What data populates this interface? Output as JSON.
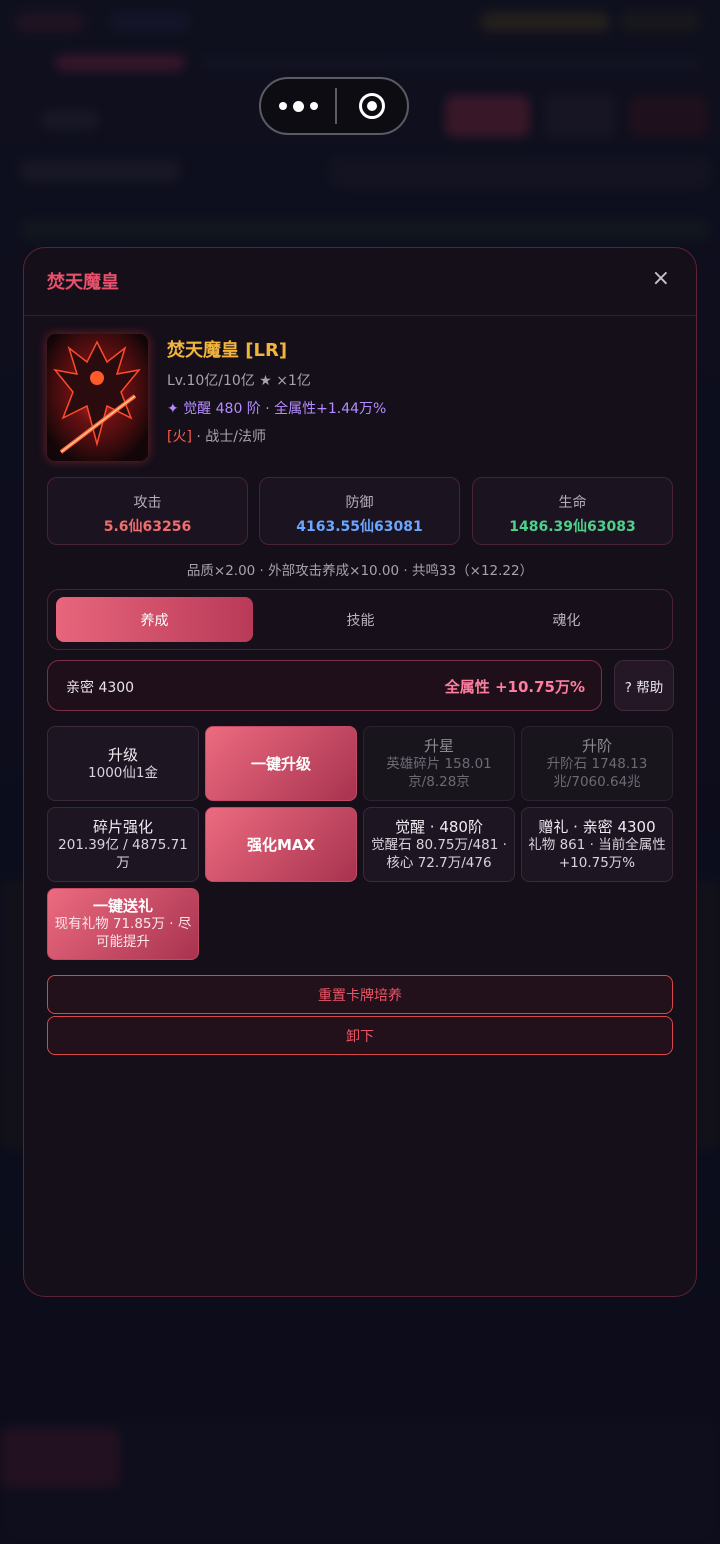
{
  "modal": {
    "title": "焚天魔皇",
    "close_icon": "close-icon",
    "close_glyph": "×"
  },
  "card": {
    "name": "焚天魔皇 [LR]",
    "level_line": "Lv.10亿/10亿 ★ ×1亿",
    "awaken_star": "✦",
    "awaken_line": "觉醒 480 阶 · 全属性+1.44万%",
    "element": "[火]",
    "role": "· 战士/法师"
  },
  "stats": [
    {
      "label": "攻击",
      "value": "5.6仙63256",
      "color": "#f26d6d"
    },
    {
      "label": "防御",
      "value": "4163.55仙63081",
      "color": "#6aa6ff"
    },
    {
      "label": "生命",
      "value": "1486.39仙63083",
      "color": "#4ed08a"
    }
  ],
  "multipliers": "品质×2.00 · 外部攻击养成×10.00 · 共鸣33（×12.22）",
  "tabs": [
    "养成",
    "技能",
    "魂化"
  ],
  "active_tab": "养成",
  "intimacy": {
    "label": "亲密 4300",
    "bonus": "全属性 +10.75万%",
    "help": "? 帮助"
  },
  "actions": {
    "upgrade": {
      "title": "升级",
      "sub": "1000仙1金"
    },
    "one_click_upgrade": {
      "title": "一键升级"
    },
    "star_up": {
      "title": "升星",
      "sub": "英雄碎片 158.01京/8.28京"
    },
    "rank_up": {
      "title": "升阶",
      "sub": "升阶石 1748.13兆/7060.64兆"
    },
    "shard_enhance": {
      "title": "碎片强化",
      "sub": "201.39亿 / 4875.71万"
    },
    "enhance_max": {
      "title": "强化MAX"
    },
    "awaken": {
      "title": "觉醒 · 480阶",
      "sub": "觉醒石 80.75万/481 · 核心 72.7万/476"
    },
    "gift": {
      "title": "赠礼 · 亲密 4300",
      "sub": "礼物 861 · 当前全属性+10.75万%"
    },
    "one_click_gift": {
      "title": "一键送礼",
      "sub": "现有礼物 71.85万 · 尽可能提升"
    }
  },
  "buttons": {
    "reset": "重置卡牌培养",
    "unequip": "卸下"
  }
}
